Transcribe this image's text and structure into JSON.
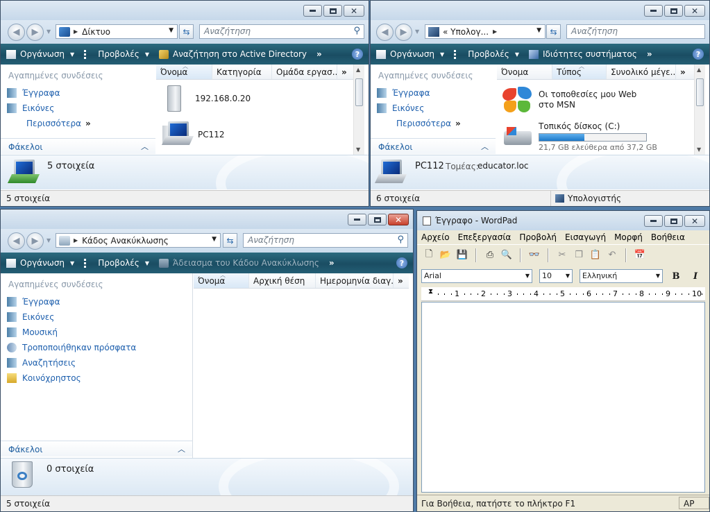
{
  "windows": {
    "network": {
      "address": "Δίκτυο",
      "search_placeholder": "Αναζήτηση",
      "cmd_organize": "Οργάνωση",
      "cmd_views": "Προβολές",
      "cmd_extra": "Αναζήτηση στο Active Directory",
      "nav_header": "Αγαπημένες συνδέσεις",
      "links": [
        "Έγγραφα",
        "Εικόνες"
      ],
      "more": "Περισσότερα",
      "folders": "Φάκελοι",
      "columns": [
        "Όνομα",
        "Κατηγορία",
        "Ομάδα εργασ..."
      ],
      "items": [
        "192.168.0.20",
        "PC112"
      ],
      "details_text": "5 στοιχεία",
      "status": "5 στοιχεία"
    },
    "computer": {
      "address": "« Υπολογ...",
      "search_placeholder": "Αναζήτηση",
      "cmd_organize": "Οργάνωση",
      "cmd_views": "Προβολές",
      "cmd_extra": "Ιδιότητες συστήματος",
      "nav_header": "Αγαπημένες συνδέσεις",
      "links": [
        "Έγγραφα",
        "Εικόνες"
      ],
      "more": "Περισσότερα",
      "folders": "Φάκελοι",
      "columns": [
        "Όνομα",
        "Τύπος",
        "Συνολικό μέγε..."
      ],
      "msn_item": "Οι τοποθεσίες μου Web στο MSN",
      "disk_label": "Τοπικός δίσκος (C:)",
      "disk_free": "21,7 GB ελεύθερα από 37,2 GB",
      "disk_used_fraction": 0.42,
      "details_name": "PC112",
      "details_domain_label": "Τομέας:",
      "details_domain": "educator.loc",
      "status": "6 στοιχεία",
      "status_right": "Υπολογιστής"
    },
    "recycle": {
      "address": "Κάδος Ανακύκλωσης",
      "search_placeholder": "Αναζήτηση",
      "cmd_organize": "Οργάνωση",
      "cmd_views": "Προβολές",
      "cmd_extra": "Άδειασμα του Κάδου Ανακύκλωσης",
      "nav_header": "Αγαπημένες συνδέσεις",
      "links": [
        "Έγγραφα",
        "Εικόνες",
        "Μουσική",
        "Τροποποιήθηκαν πρόσφατα",
        "Αναζητήσεις",
        "Κοινόχρηστος"
      ],
      "folders": "Φάκελοι",
      "columns": [
        "Όνομα",
        "Αρχική θέση",
        "Ημερομηνία διαγ..."
      ],
      "details_text": "0 στοιχεία",
      "status": "5 στοιχεία"
    },
    "wordpad": {
      "title": "Έγγραφο - WordPad",
      "menu": [
        "Αρχείο",
        "Επεξεργασία",
        "Προβολή",
        "Εισαγωγή",
        "Μορφή",
        "Βοήθεια"
      ],
      "font": "Arial",
      "size": "10",
      "script": "Ελληνική",
      "ruler": [
        "1",
        "2",
        "3",
        "4",
        "5",
        "6",
        "7",
        "8",
        "9",
        "10"
      ],
      "status": "Για Βοήθεια, πατήστε το πλήκτρο F1",
      "status_right": "ΑΡ"
    }
  },
  "colors": {
    "link": "#1d5fad",
    "cmdbar": "#1a4d63",
    "disk_bar": "#2a8ad6"
  }
}
